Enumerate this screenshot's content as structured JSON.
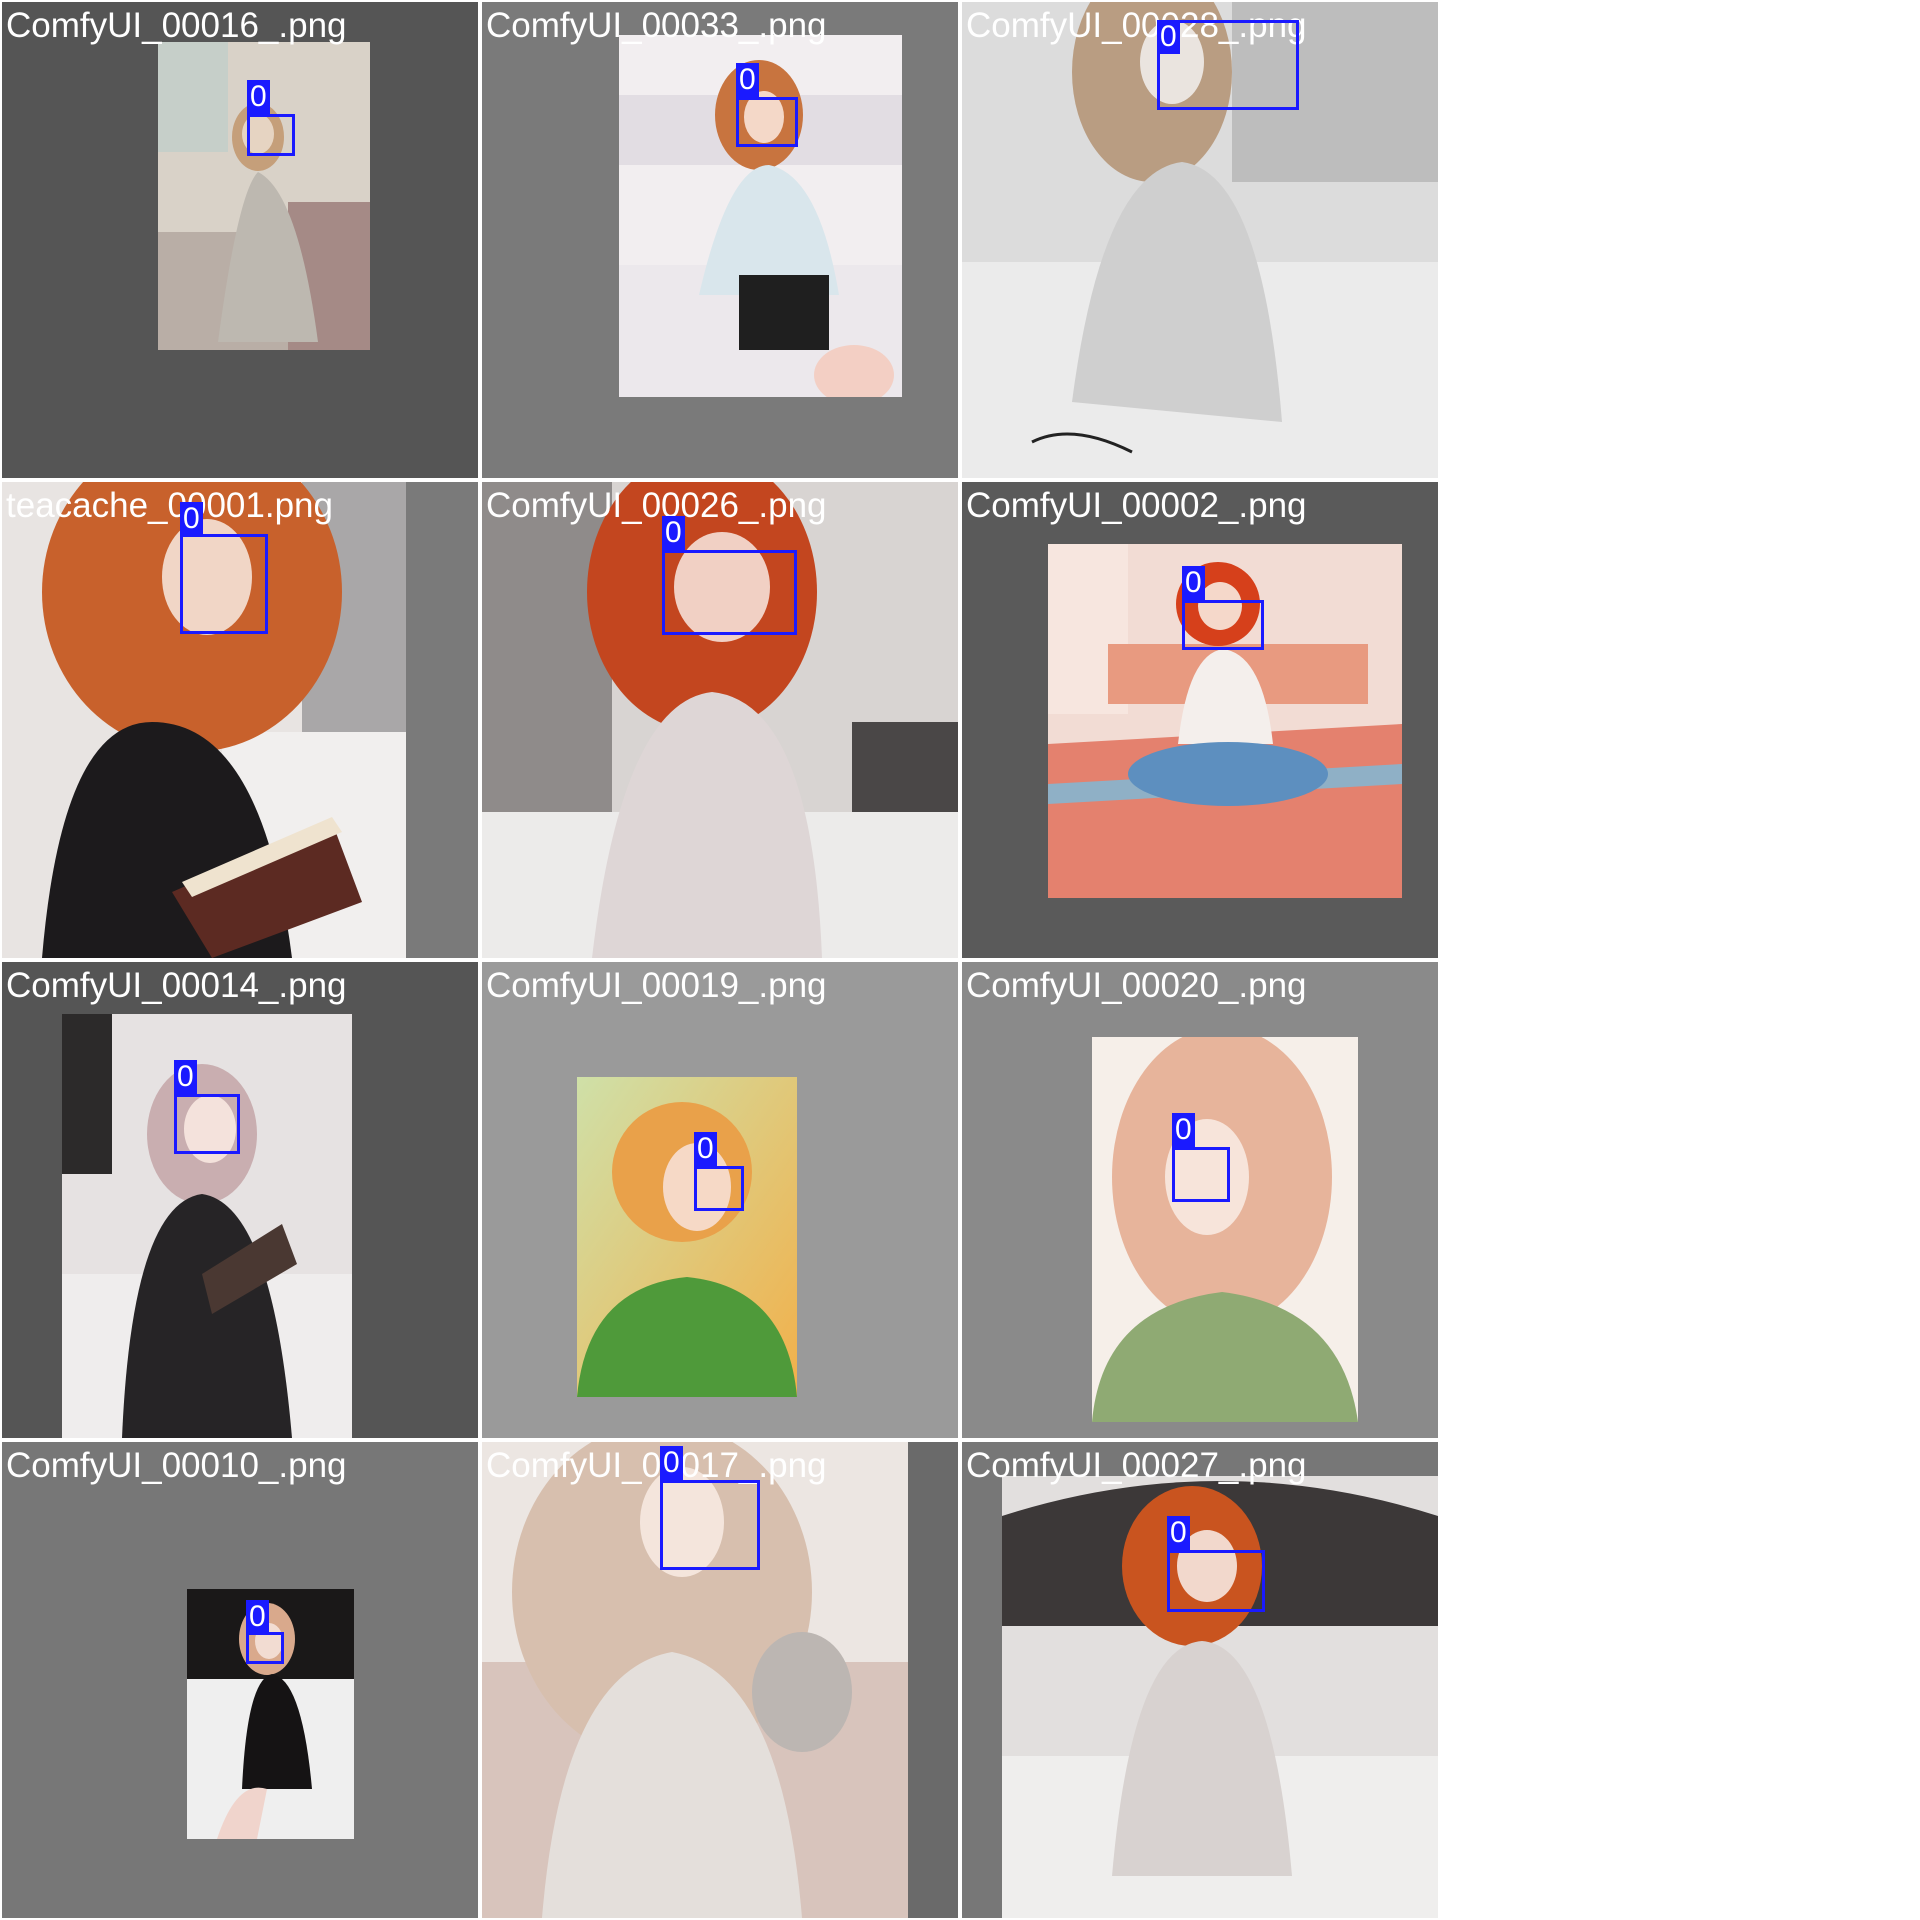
{
  "page": {
    "background": "#ffffff"
  },
  "bbox_color": "#1a1aff",
  "tiles": [
    {
      "filename": "ComfyUI_00016_.png",
      "cell_bg": "#555555",
      "detections": [
        {
          "class_label": "0"
        }
      ]
    },
    {
      "filename": "ComfyUI_00033_.png",
      "cell_bg": "#7a7a7a",
      "detections": [
        {
          "class_label": "0"
        }
      ]
    },
    {
      "filename": "ComfyUI_00028_.png",
      "cell_bg": "#8a8a8a",
      "detections": [
        {
          "class_label": "0"
        }
      ]
    },
    {
      "filename": "teacache_00001.png",
      "cell_bg": "#7a7a7a",
      "detections": [
        {
          "class_label": "0"
        }
      ]
    },
    {
      "filename": "ComfyUI_00026_.png",
      "cell_bg": "#6a6a6a",
      "detections": [
        {
          "class_label": "0"
        }
      ]
    },
    {
      "filename": "ComfyUI_00002_.png",
      "cell_bg": "#5a5a5a",
      "detections": [
        {
          "class_label": "0"
        }
      ]
    },
    {
      "filename": "ComfyUI_00014_.png",
      "cell_bg": "#555555",
      "detections": [
        {
          "class_label": "0"
        }
      ]
    },
    {
      "filename": "ComfyUI_00019_.png",
      "cell_bg": "#9a9a9a",
      "detections": [
        {
          "class_label": "0"
        }
      ]
    },
    {
      "filename": "ComfyUI_00020_.png",
      "cell_bg": "#8a8a8a",
      "detections": [
        {
          "class_label": "0"
        }
      ]
    },
    {
      "filename": "ComfyUI_00010_.png",
      "cell_bg": "#777777",
      "detections": [
        {
          "class_label": "0"
        }
      ]
    },
    {
      "filename": "ComfyUI_00017_.png",
      "cell_bg": "#6a6a6a",
      "detections": [
        {
          "class_label": "0"
        }
      ]
    },
    {
      "filename": "ComfyUI_00027_.png",
      "cell_bg": "#777777",
      "detections": [
        {
          "class_label": "0"
        }
      ]
    }
  ]
}
